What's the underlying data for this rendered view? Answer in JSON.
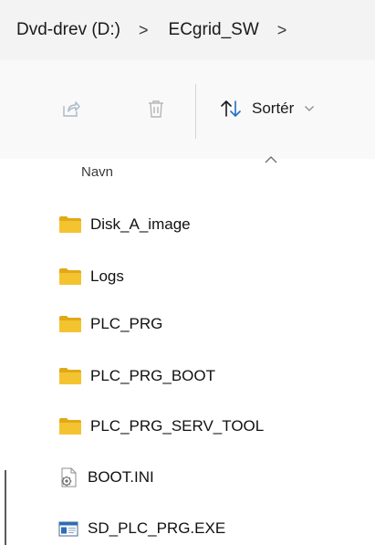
{
  "breadcrumb": {
    "items": [
      "Dvd-drev (D:)",
      "ECgrid_SW"
    ],
    "separator": ">"
  },
  "toolbar": {
    "share_icon": "share-icon",
    "delete_icon": "trash-icon",
    "sort_label": "Sortér"
  },
  "column_header": {
    "name_label": "Navn"
  },
  "files": [
    {
      "name": "Disk_A_image",
      "type": "folder"
    },
    {
      "name": "Logs",
      "type": "folder"
    },
    {
      "name": "PLC_PRG",
      "type": "folder"
    },
    {
      "name": "PLC_PRG_BOOT",
      "type": "folder"
    },
    {
      "name": "PLC_PRG_SERV_TOOL",
      "type": "folder"
    },
    {
      "name": "BOOT.INI",
      "type": "ini-file"
    },
    {
      "name": "SD_PLC_PRG.EXE",
      "type": "exe-file"
    }
  ],
  "colors": {
    "folder": "#f4c430",
    "folder_tab": "#e1a917",
    "breadcrumb_bg": "#f3f3f3",
    "toolbar_bg": "#f9f9f9",
    "sort_arrow": "#1f6fc1"
  }
}
